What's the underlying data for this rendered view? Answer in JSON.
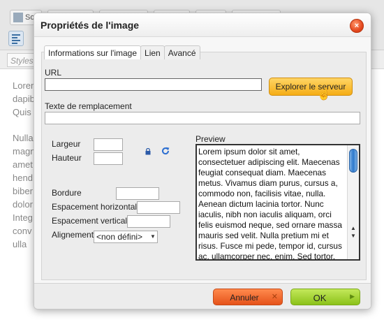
{
  "background": {
    "toolbar_items": [
      "So",
      "",
      "",
      "",
      "",
      ""
    ],
    "styles_placeholder": "Styles",
    "content_lines": [
      [
        "Lorem",
        "dapib",
        "Quis"
      ],
      [
        "Nulla",
        "magn",
        "amet",
        "hend",
        "biber",
        "dolor",
        "Integ",
        "conv",
        "ulla"
      ]
    ]
  },
  "dialog": {
    "title": "Propriétés de l'image",
    "close_label": "×",
    "tabs": [
      {
        "label": "Informations sur l'image",
        "active": true
      },
      {
        "label": "Lien",
        "active": false
      },
      {
        "label": "Avancé",
        "active": false
      }
    ],
    "url": {
      "label": "URL",
      "value": ""
    },
    "browse_button": "Explorer le serveur",
    "alt": {
      "label": "Texte de remplacement",
      "value": ""
    },
    "width": {
      "label": "Largeur",
      "value": ""
    },
    "height": {
      "label": "Hauteur",
      "value": ""
    },
    "border": {
      "label": "Bordure",
      "value": ""
    },
    "hspace": {
      "label": "Espacement horizontal",
      "value": ""
    },
    "vspace": {
      "label": "Espacement vertical",
      "value": ""
    },
    "align": {
      "label": "Alignement",
      "selected": "<non défini>"
    },
    "preview": {
      "label": "Preview",
      "text": "Lorem ipsum dolor sit amet, consectetuer adipiscing elit. Maecenas feugiat consequat diam. Maecenas metus. Vivamus diam purus, cursus a, commodo non, facilisis vitae, nulla. Aenean dictum lacinia tortor. Nunc iaculis, nibh non iaculis aliquam, orci felis euismod neque, sed ornare massa mauris sed velit. Nulla pretium mi et risus. Fusce mi pede, tempor id, cursus ac, ullamcorper nec, enim. Sed tortor."
    },
    "cancel_button": "Annuler",
    "ok_button": "OK"
  },
  "colors": {
    "browse_button": "#f5ad16",
    "cancel_button": "#e5521a",
    "ok_button": "#8bc21a",
    "close_button": "#e5491f"
  }
}
